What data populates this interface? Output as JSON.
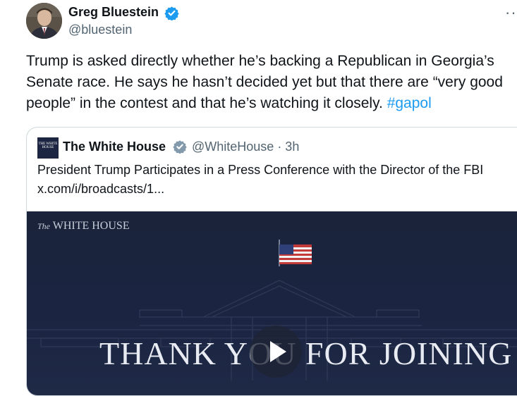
{
  "author": {
    "name": "Greg Bluestein",
    "handle": "@bluestein",
    "verified": true,
    "verified_color": "#1d9bf0"
  },
  "more_menu": "··",
  "tweet": {
    "lines": [
      "Trump is asked directly whether he’s backing a Republican in Georgia’s",
      "Senate race. He says he hasn’t decided yet but that there are “very good",
      "people” in the contest and that he’s watching it closely. "
    ],
    "hashtag": "#gapol",
    "hashtag_color": "#1d9bf0"
  },
  "quoted": {
    "avatar_text": "THE WHITE HOUSE",
    "name": "The White House",
    "verified": true,
    "verified_color": "#829aab",
    "handle_time": "@WhiteHouse · 3h",
    "title": "President Trump Participates in a Press Conference with the Director of the FBI",
    "link": "x.com/i/broadcasts/1...",
    "media": {
      "label_prefix": "The",
      "label_main": "WHITE HOUSE",
      "headline": "THANK YOU FOR JOINING",
      "play_icon": "play-icon"
    }
  }
}
